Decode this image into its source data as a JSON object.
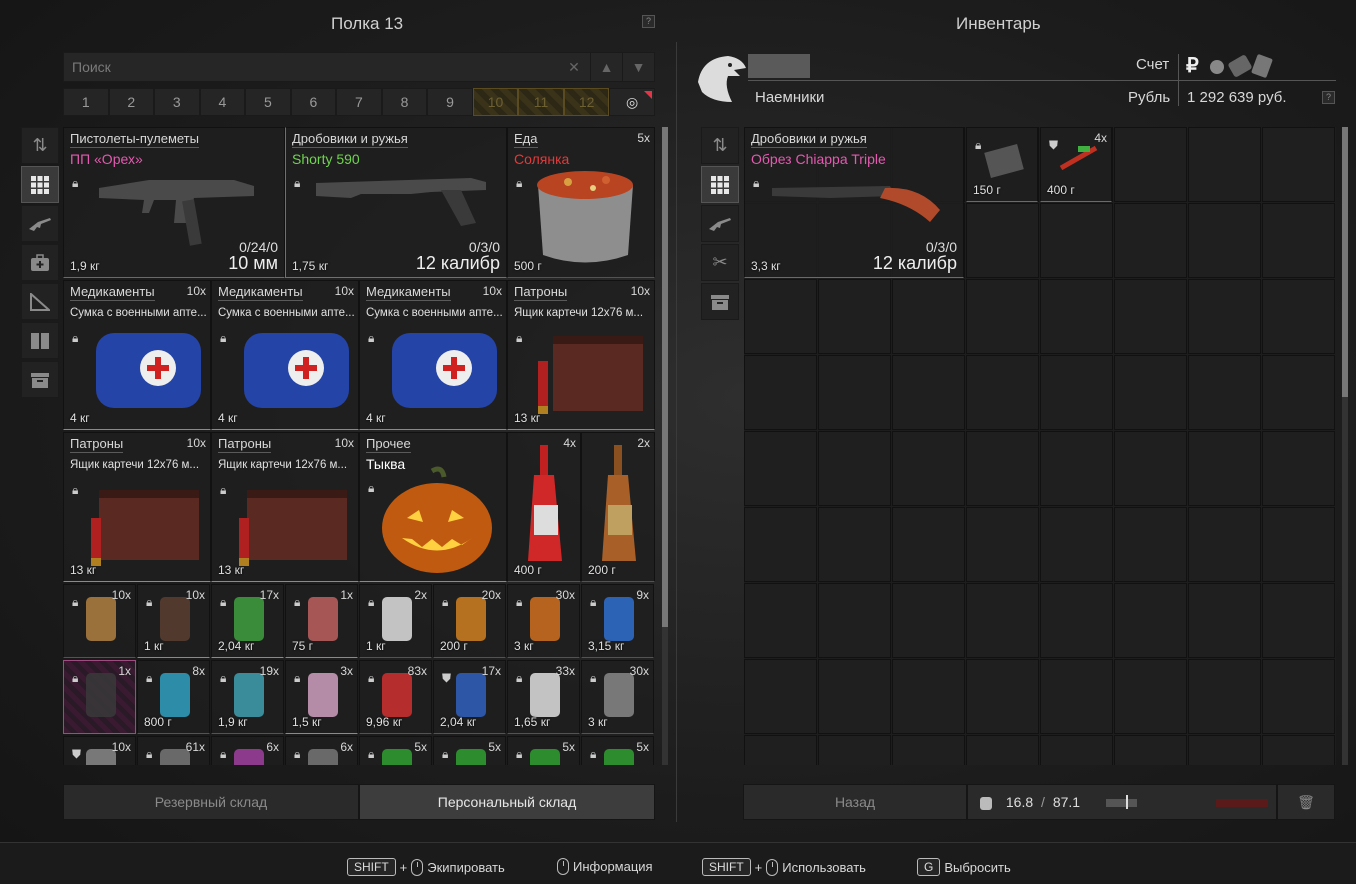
{
  "left": {
    "title": "Полка 13",
    "help": "?",
    "search_placeholder": "Поиск",
    "pages": [
      "1",
      "2",
      "3",
      "4",
      "5",
      "6",
      "7",
      "8",
      "9",
      "10",
      "11",
      "12"
    ],
    "special_page_icon": "target-icon",
    "tabs": {
      "reserve": "Резервный склад",
      "personal": "Персональный склад"
    }
  },
  "items": [
    {
      "cat": "Пистолеты-пулеметы",
      "name": "ПП «Орех»",
      "name_color": "#e35ab0",
      "wt": "1,9 кг",
      "ammo": "0/24/0",
      "cal": "10 мм"
    },
    {
      "cat": "Дробовики и ружья",
      "name": "Shorty 590",
      "name_color": "#6fd44e",
      "wt": "1,75 кг",
      "ammo": "0/3/0",
      "cal": "12 калибр"
    },
    {
      "cat": "Еда",
      "name": "Солянка",
      "name_color": "#e23a3a",
      "wt": "500 г",
      "qty": "5x"
    },
    {
      "cat": "Медикаменты",
      "desc": "Сумка с военными апте...",
      "wt": "4 кг",
      "qty": "10x"
    },
    {
      "cat": "Медикаменты",
      "desc": "Сумка с военными апте...",
      "wt": "4 кг",
      "qty": "10x"
    },
    {
      "cat": "Медикаменты",
      "desc": "Сумка с военными апте...",
      "wt": "4 кг",
      "qty": "10x"
    },
    {
      "cat": "Патроны",
      "desc": "Ящик картечи 12x76 м...",
      "wt": "13 кг",
      "qty": "10x"
    },
    {
      "cat": "Патроны",
      "desc": "Ящик картечи 12x76 м...",
      "wt": "13 кг",
      "qty": "10x"
    },
    {
      "cat": "Патроны",
      "desc": "Ящик картечи 12x76 м...",
      "wt": "13 кг",
      "qty": "10x"
    },
    {
      "cat": "Прочее",
      "name": "Тыква",
      "name_color": "#ffffff"
    },
    {
      "wt": "400 г",
      "qty": "4x"
    },
    {
      "wt": "200 г",
      "qty": "2x"
    }
  ],
  "small_rows": [
    [
      {
        "qty": "10x",
        "wt": ""
      },
      {
        "qty": "10x",
        "wt": "1 кг"
      },
      {
        "qty": "17x",
        "wt": "2,04 кг"
      },
      {
        "qty": "1x",
        "wt": "75 г"
      },
      {
        "qty": "2x",
        "wt": "1 кг"
      },
      {
        "qty": "20x",
        "wt": "200 г"
      },
      {
        "qty": "30x",
        "wt": "3 кг"
      },
      {
        "qty": "9x",
        "wt": "3,15 кг"
      }
    ],
    [
      {
        "qty": "1x",
        "wt": ""
      },
      {
        "qty": "8x",
        "wt": "800 г"
      },
      {
        "qty": "19x",
        "wt": "1,9 кг"
      },
      {
        "qty": "3x",
        "wt": "1,5 кг"
      },
      {
        "qty": "83x",
        "wt": "9,96 кг"
      },
      {
        "qty": "17x",
        "wt": "2,04 кг"
      },
      {
        "qty": "33x",
        "wt": "1,65 кг"
      },
      {
        "qty": "30x",
        "wt": "3 кг"
      }
    ],
    [
      {
        "qty": "10x",
        "wt": ""
      },
      {
        "qty": "61x",
        "wt": ""
      },
      {
        "qty": "6x",
        "wt": ""
      },
      {
        "qty": "6x",
        "wt": ""
      },
      {
        "qty": "5x",
        "wt": ""
      },
      {
        "qty": "5x",
        "wt": ""
      },
      {
        "qty": "5x",
        "wt": ""
      },
      {
        "qty": "5x",
        "wt": ""
      }
    ]
  ],
  "right": {
    "title": "Инвентарь",
    "faction": "Наемники",
    "account_label": "Счет",
    "currency_label": "Рубль",
    "balance": "1 292 639 руб.",
    "help": "?",
    "item": {
      "cat": "Дробовики и ружья",
      "name": "Обрез Chiappa Triple",
      "name_color": "#e35ab0",
      "wt": "3,3 кг",
      "ammo": "0/3/0",
      "cal": "12 калибр"
    },
    "small": [
      {
        "wt": "150 г"
      },
      {
        "wt": "400 г",
        "qty": "4x"
      }
    ],
    "back": "Назад",
    "weight_current": "16.8",
    "weight_sep": "/",
    "weight_max": "87.1"
  },
  "hints": {
    "shift": "SHIFT",
    "plus": "+",
    "equip": "Экипировать",
    "info": "Информация",
    "use": "Использовать",
    "g_key": "G",
    "drop": "Выбросить"
  }
}
